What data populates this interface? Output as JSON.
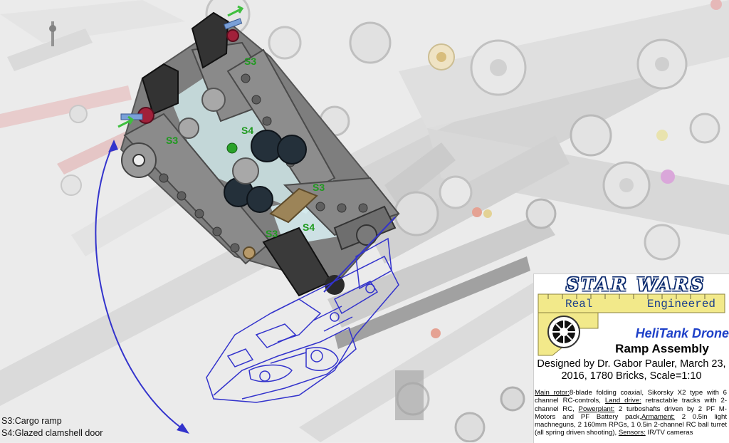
{
  "labels": {
    "s3_a": "S3",
    "s3_b": "S3",
    "s3_c": "S3",
    "s3_d": "S3",
    "s4_a": "S4",
    "s4_b": "S4"
  },
  "legend": {
    "line1": "S3:Cargo ramp",
    "line2": "S4:Glazed clamshell door"
  },
  "info_panel": {
    "brand_title": "STAR WARS",
    "tag_real": "Real",
    "tag_engineered": "Engineered",
    "model_name": "HeliTank Drone",
    "subtitle": "Ramp Assembly",
    "credits": "Designed by Dr. Gabor Pauler, March 23, 2016, 1780 Bricks, Scale=1:10",
    "specs": {
      "main_rotor_label": "Main rotor:",
      "main_rotor_text": "8-blade folding coaxial, Sikorsky X2 type with 6 channel RC-controls, ",
      "land_drive_label": "Land drive:",
      "land_drive_text": " retractable tracks with 2-channel RC, ",
      "powerplant_label": "Powerplant:",
      "powerplant_text": " 2 turboshafts driven by 2 PF M-Motors and PF Battery pack,",
      "armament_label": "Armament:",
      "armament_text": " 2 0.5in light machneguns, 2 160mm RPGs, 1 0.5in 2-channel RC ball turret (all spring driven shooting), ",
      "sensors_label": "Sensors:",
      "sensors_text": "  IR/TV cameras"
    }
  },
  "colors": {
    "label_green": "#1f9a1f",
    "arrow_blue": "#3333cc",
    "title_blue": "#1e40c8",
    "caliper_yellow": "#f2e98a"
  }
}
